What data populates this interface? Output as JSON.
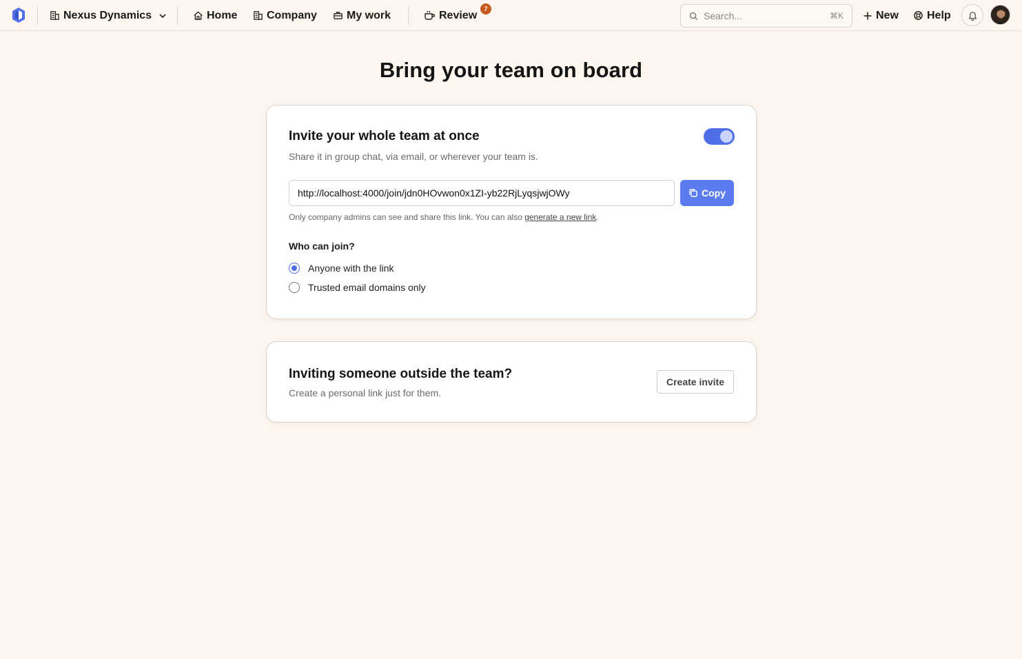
{
  "topbar": {
    "company": "Nexus Dynamics",
    "nav": {
      "home": "Home",
      "company": "Company",
      "my_work": "My work",
      "review": "Review",
      "review_badge": "7"
    },
    "search": {
      "placeholder": "Search...",
      "shortcut": "⌘K"
    },
    "new_label": "New",
    "help_label": "Help"
  },
  "page": {
    "title": "Bring your team on board"
  },
  "invite_card": {
    "title": "Invite your whole team at once",
    "subtitle": "Share it in group chat, via email, or wherever your team is.",
    "toggle_on": true,
    "link_value": "http://localhost:4000/join/jdn0HOvwon0x1ZI-yb22RjLyqsjwjOWy",
    "copy_label": "Copy",
    "hint_text": "Only company admins can see and share this link. You can also ",
    "hint_link": "generate a new link",
    "hint_end": ".",
    "who_label": "Who can join?",
    "options": [
      {
        "label": "Anyone with the link",
        "checked": true
      },
      {
        "label": "Trusted email domains only",
        "checked": false
      }
    ]
  },
  "outside_card": {
    "title": "Inviting someone outside the team?",
    "subtitle": "Create a personal link just for them.",
    "button_label": "Create invite"
  },
  "colors": {
    "accent": "#5b7cf0",
    "badge": "#c65a1e",
    "background": "#fdf6ee"
  }
}
